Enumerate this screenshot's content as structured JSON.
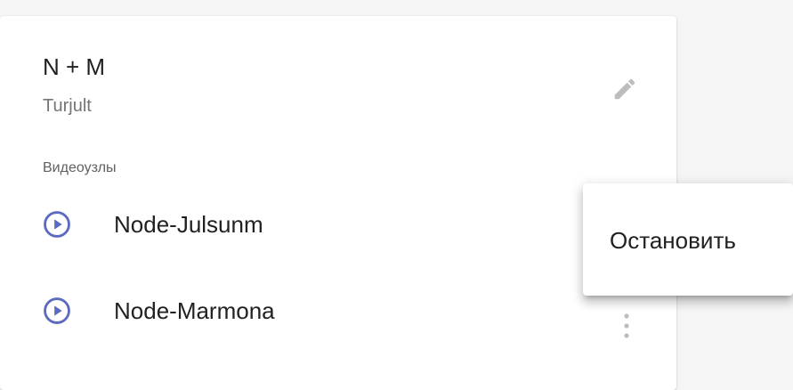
{
  "card": {
    "title": "N + M",
    "subtitle": "Turjult",
    "section_label": "Видеоузлы",
    "edit_icon": "pencil-icon",
    "nodes": [
      {
        "label": "Node-Julsunm",
        "icon": "play-circle-icon"
      },
      {
        "label": "Node-Marmona",
        "icon": "play-circle-icon"
      }
    ],
    "more_icon": "more-vert-icon"
  },
  "context_menu": {
    "items": [
      {
        "label": "Остановить"
      }
    ]
  },
  "colors": {
    "accent": "#5c6bc0",
    "icon_gray": "#bdbdbd",
    "text_primary": "#212121",
    "text_secondary": "#757575",
    "background": "#f5f5f5"
  }
}
